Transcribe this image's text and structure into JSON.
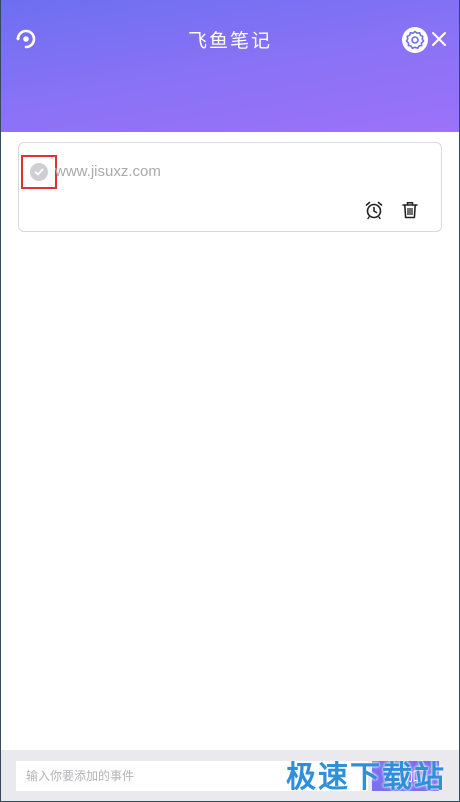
{
  "header": {
    "title": "飞鱼笔记",
    "logo_icon": "refresh-logo-icon",
    "settings_icon": "gear-icon",
    "close_icon": "close-icon",
    "gradient_start": "#6d6ff0",
    "gradient_end": "#9c72f8"
  },
  "notes": [
    {
      "text": "www.jisuxz.com",
      "completed": false,
      "alarm_icon": "alarm-clock-icon",
      "delete_icon": "trash-icon"
    }
  ],
  "footer": {
    "input_placeholder": "输入你要添加的事件",
    "input_value": "",
    "add_label": "添加",
    "accent": "#7b6ff2"
  },
  "watermark": {
    "text": "极速下载站"
  }
}
